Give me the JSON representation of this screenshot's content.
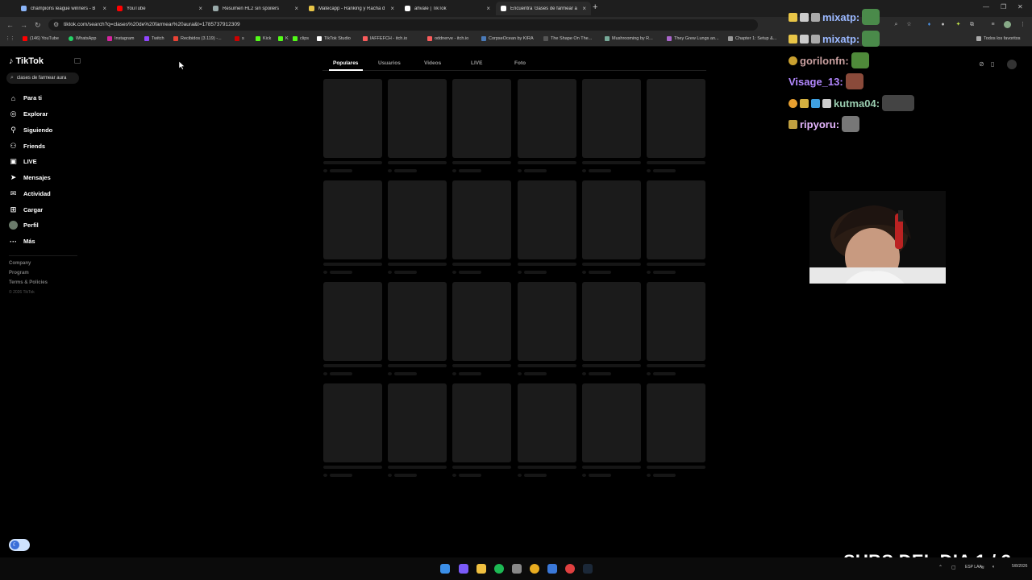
{
  "browser": {
    "tabs": [
      {
        "title": "champions league winners - B"
      },
      {
        "title": "YouTube"
      },
      {
        "title": "Resumen HL2 sin spoilers"
      },
      {
        "title": "Matecapp - Ranking y Racha d"
      },
      {
        "title": "ahvale | TikTok"
      },
      {
        "title": "Encuentra 'clases de farmear a"
      }
    ],
    "url": "tiktok.com/search?q=clases%20de%20farmear%20aura&t=1785737912309",
    "bookmarks": [
      "(146) YouTube",
      "WhatsApp",
      "Instagram",
      "Twitch",
      "Recibidos (3.119) -...",
      "s",
      "Kick",
      "K",
      "clips",
      "TikTok Studio",
      "IAFFEFCH - itch.io",
      "oddnerve - itch.io",
      "CorpseOcean by KIRA",
      "The Shape On The...",
      "Mushrooming by R...",
      "They Grew Lungs an...",
      "Chapter 1: Setup &..."
    ],
    "all_bookmarks": "Todos los favoritos"
  },
  "tiktok": {
    "logo": "TikTok",
    "search_query": "clases de farmear aura",
    "nav": [
      {
        "label": "Para ti",
        "icon": "home-icon"
      },
      {
        "label": "Explorar",
        "icon": "compass-icon"
      },
      {
        "label": "Siguiendo",
        "icon": "following-icon"
      },
      {
        "label": "Friends",
        "icon": "friends-icon"
      },
      {
        "label": "LIVE",
        "icon": "live-icon"
      },
      {
        "label": "Mensajes",
        "icon": "messages-icon"
      },
      {
        "label": "Actividad",
        "icon": "activity-icon"
      },
      {
        "label": "Cargar",
        "icon": "upload-icon"
      },
      {
        "label": "Perfil",
        "icon": "profile-avatar"
      },
      {
        "label": "Más",
        "icon": "more-icon"
      }
    ],
    "footer": {
      "company": "Company",
      "program": "Program",
      "terms": "Terms & Policies",
      "copyright": "© 2026 TikTok"
    },
    "search_tabs": [
      "Populares",
      "Usuarios",
      "Videos",
      "LIVE",
      "Foto"
    ],
    "active_tab": "Populares"
  },
  "stream": {
    "chat": [
      {
        "user": "mixatp:",
        "color": "#9ab8ff"
      },
      {
        "user": "mixatp:",
        "color": "#9ab8ff"
      },
      {
        "user": "gorilonfn:",
        "color": "#c9a0a0"
      },
      {
        "user": "Visage_13:",
        "color": "#b388ff"
      },
      {
        "user": "kutma04:",
        "color": "#9acdb0"
      },
      {
        "user": "ripyoru:",
        "color": "#e6b7ff"
      }
    ],
    "subs_banner": "SUBS DEL DIA 1 / 3"
  },
  "taskbar": {
    "lang": "ESP LAA",
    "date": "5/8/2026"
  }
}
